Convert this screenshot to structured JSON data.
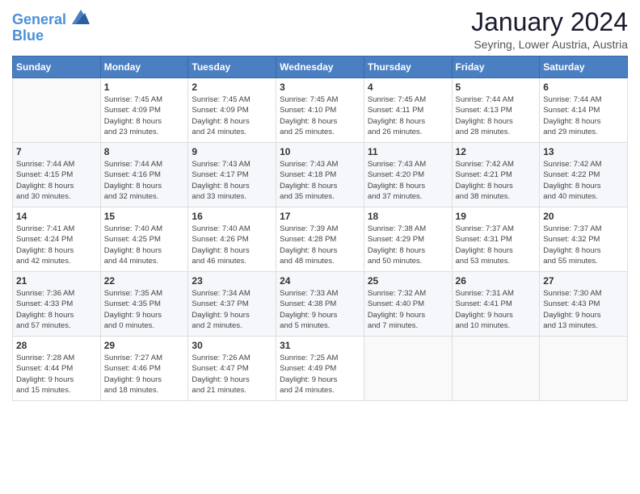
{
  "logo": {
    "line1": "General",
    "line2": "Blue"
  },
  "title": "January 2024",
  "location": "Seyring, Lower Austria, Austria",
  "header_days": [
    "Sunday",
    "Monday",
    "Tuesday",
    "Wednesday",
    "Thursday",
    "Friday",
    "Saturday"
  ],
  "weeks": [
    [
      {
        "day": "",
        "info": ""
      },
      {
        "day": "1",
        "info": "Sunrise: 7:45 AM\nSunset: 4:09 PM\nDaylight: 8 hours\nand 23 minutes."
      },
      {
        "day": "2",
        "info": "Sunrise: 7:45 AM\nSunset: 4:09 PM\nDaylight: 8 hours\nand 24 minutes."
      },
      {
        "day": "3",
        "info": "Sunrise: 7:45 AM\nSunset: 4:10 PM\nDaylight: 8 hours\nand 25 minutes."
      },
      {
        "day": "4",
        "info": "Sunrise: 7:45 AM\nSunset: 4:11 PM\nDaylight: 8 hours\nand 26 minutes."
      },
      {
        "day": "5",
        "info": "Sunrise: 7:44 AM\nSunset: 4:13 PM\nDaylight: 8 hours\nand 28 minutes."
      },
      {
        "day": "6",
        "info": "Sunrise: 7:44 AM\nSunset: 4:14 PM\nDaylight: 8 hours\nand 29 minutes."
      }
    ],
    [
      {
        "day": "7",
        "info": "Sunrise: 7:44 AM\nSunset: 4:15 PM\nDaylight: 8 hours\nand 30 minutes."
      },
      {
        "day": "8",
        "info": "Sunrise: 7:44 AM\nSunset: 4:16 PM\nDaylight: 8 hours\nand 32 minutes."
      },
      {
        "day": "9",
        "info": "Sunrise: 7:43 AM\nSunset: 4:17 PM\nDaylight: 8 hours\nand 33 minutes."
      },
      {
        "day": "10",
        "info": "Sunrise: 7:43 AM\nSunset: 4:18 PM\nDaylight: 8 hours\nand 35 minutes."
      },
      {
        "day": "11",
        "info": "Sunrise: 7:43 AM\nSunset: 4:20 PM\nDaylight: 8 hours\nand 37 minutes."
      },
      {
        "day": "12",
        "info": "Sunrise: 7:42 AM\nSunset: 4:21 PM\nDaylight: 8 hours\nand 38 minutes."
      },
      {
        "day": "13",
        "info": "Sunrise: 7:42 AM\nSunset: 4:22 PM\nDaylight: 8 hours\nand 40 minutes."
      }
    ],
    [
      {
        "day": "14",
        "info": "Sunrise: 7:41 AM\nSunset: 4:24 PM\nDaylight: 8 hours\nand 42 minutes."
      },
      {
        "day": "15",
        "info": "Sunrise: 7:40 AM\nSunset: 4:25 PM\nDaylight: 8 hours\nand 44 minutes."
      },
      {
        "day": "16",
        "info": "Sunrise: 7:40 AM\nSunset: 4:26 PM\nDaylight: 8 hours\nand 46 minutes."
      },
      {
        "day": "17",
        "info": "Sunrise: 7:39 AM\nSunset: 4:28 PM\nDaylight: 8 hours\nand 48 minutes."
      },
      {
        "day": "18",
        "info": "Sunrise: 7:38 AM\nSunset: 4:29 PM\nDaylight: 8 hours\nand 50 minutes."
      },
      {
        "day": "19",
        "info": "Sunrise: 7:37 AM\nSunset: 4:31 PM\nDaylight: 8 hours\nand 53 minutes."
      },
      {
        "day": "20",
        "info": "Sunrise: 7:37 AM\nSunset: 4:32 PM\nDaylight: 8 hours\nand 55 minutes."
      }
    ],
    [
      {
        "day": "21",
        "info": "Sunrise: 7:36 AM\nSunset: 4:33 PM\nDaylight: 8 hours\nand 57 minutes."
      },
      {
        "day": "22",
        "info": "Sunrise: 7:35 AM\nSunset: 4:35 PM\nDaylight: 9 hours\nand 0 minutes."
      },
      {
        "day": "23",
        "info": "Sunrise: 7:34 AM\nSunset: 4:37 PM\nDaylight: 9 hours\nand 2 minutes."
      },
      {
        "day": "24",
        "info": "Sunrise: 7:33 AM\nSunset: 4:38 PM\nDaylight: 9 hours\nand 5 minutes."
      },
      {
        "day": "25",
        "info": "Sunrise: 7:32 AM\nSunset: 4:40 PM\nDaylight: 9 hours\nand 7 minutes."
      },
      {
        "day": "26",
        "info": "Sunrise: 7:31 AM\nSunset: 4:41 PM\nDaylight: 9 hours\nand 10 minutes."
      },
      {
        "day": "27",
        "info": "Sunrise: 7:30 AM\nSunset: 4:43 PM\nDaylight: 9 hours\nand 13 minutes."
      }
    ],
    [
      {
        "day": "28",
        "info": "Sunrise: 7:28 AM\nSunset: 4:44 PM\nDaylight: 9 hours\nand 15 minutes."
      },
      {
        "day": "29",
        "info": "Sunrise: 7:27 AM\nSunset: 4:46 PM\nDaylight: 9 hours\nand 18 minutes."
      },
      {
        "day": "30",
        "info": "Sunrise: 7:26 AM\nSunset: 4:47 PM\nDaylight: 9 hours\nand 21 minutes."
      },
      {
        "day": "31",
        "info": "Sunrise: 7:25 AM\nSunset: 4:49 PM\nDaylight: 9 hours\nand 24 minutes."
      },
      {
        "day": "",
        "info": ""
      },
      {
        "day": "",
        "info": ""
      },
      {
        "day": "",
        "info": ""
      }
    ]
  ]
}
